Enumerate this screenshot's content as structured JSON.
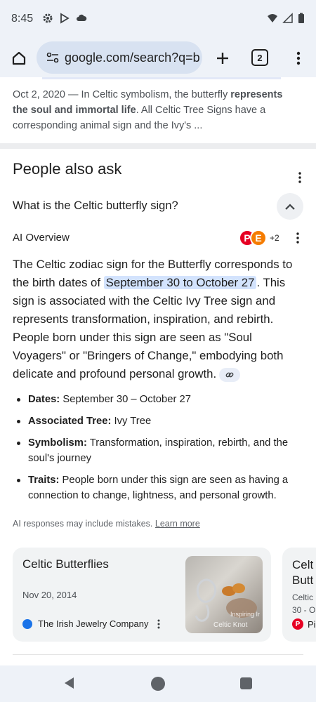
{
  "status_bar": {
    "time": "8:45"
  },
  "toolbar": {
    "url": "google.com/search?q=b",
    "tab_count": "2"
  },
  "snippet": {
    "date_prefix": "Oct 2, 2020 — In Celtic symbolism, the butterfly ",
    "bold1": "represents the soul and immortal life",
    "mid": ". All Celtic Tree Signs have a corresponding animal sign and the Ivy's ..."
  },
  "people_also_ask": {
    "title": "People also ask",
    "question": "What is the Celtic butterfly sign?"
  },
  "ai_overview": {
    "label": "AI Overview",
    "source_more": "+2",
    "para_start": "The Celtic zodiac sign for the Butterfly corresponds to the birth dates of ",
    "highlight": "September 30 to October 27",
    "para_end": ". This sign is associated with the Celtic Ivy Tree sign and represents transformation, inspiration, and rebirth. People born under this sign are seen as \"Soul Voyagers\" or \"Bringers of Change,\" embodying both delicate and profound personal growth.",
    "bullets": [
      {
        "key": "Dates:",
        "text": " September 30 – October 27"
      },
      {
        "key": "Associated Tree:",
        "text": " Ivy Tree"
      },
      {
        "key": "Symbolism:",
        "text": " Transformation, inspiration, rebirth, and the soul's journey"
      },
      {
        "key": "Traits:",
        "text": " People born under this sign are seen as having a connection to change, lightness, and personal growth."
      }
    ],
    "disclaimer": "AI responses may include mistakes. ",
    "learn_more": "Learn more"
  },
  "cards": [
    {
      "title": "Celtic Butterflies",
      "date": "Nov 20, 2014",
      "source": "The Irish Jewelry Company",
      "thumb_text1": "Inspiring Ir",
      "thumb_text2": "Celtic Knot"
    },
    {
      "title": "Celt Butt",
      "snippet": "Celtic 30 - O",
      "source": "Pi"
    }
  ]
}
